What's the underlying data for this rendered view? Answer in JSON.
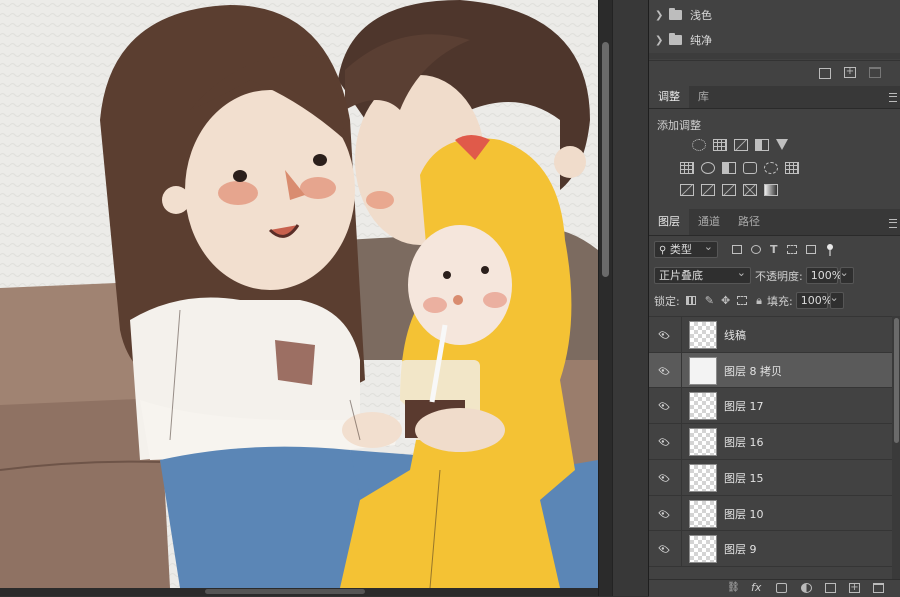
{
  "folders": [
    {
      "label": "浅色"
    },
    {
      "label": "纯净"
    }
  ],
  "adjustments_panel": {
    "tabs": [
      {
        "label": "调整",
        "active": true
      },
      {
        "label": "库",
        "active": false
      }
    ],
    "heading": "添加调整"
  },
  "layers_panel": {
    "tabs": [
      {
        "label": "图层",
        "active": true
      },
      {
        "label": "通道",
        "active": false
      },
      {
        "label": "路径",
        "active": false
      }
    ],
    "filter_type": "类型",
    "blend_mode": "正片叠底",
    "opacity_label": "不透明度:",
    "opacity_value": "100%",
    "lock_label": "锁定:",
    "fill_label": "填充:",
    "fill_value": "100%",
    "layers": [
      {
        "name": "线稿",
        "selected": false,
        "thumb": "checker"
      },
      {
        "name": "图层 8 拷贝",
        "selected": true,
        "thumb": "solid"
      },
      {
        "name": "图层 17",
        "selected": false,
        "thumb": "checker"
      },
      {
        "name": "图层 16",
        "selected": false,
        "thumb": "checker"
      },
      {
        "name": "图层 15",
        "selected": false,
        "thumb": "checker"
      },
      {
        "name": "图层 10",
        "selected": false,
        "thumb": "checker"
      },
      {
        "name": "图层 9",
        "selected": false,
        "thumb": "checker"
      }
    ]
  },
  "bottom_bar": {
    "fx_label": "fx"
  },
  "colors": {
    "panel_bg": "#424242",
    "selected_row": "#5a5a5a",
    "canvas_bg": "#2a2a2a"
  }
}
